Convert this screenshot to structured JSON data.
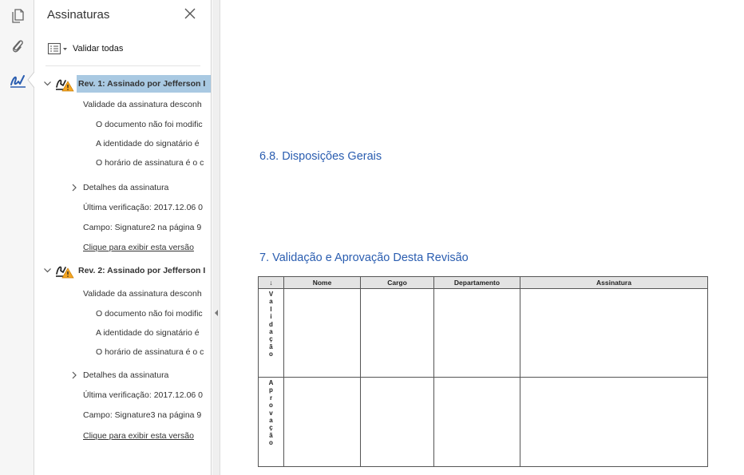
{
  "colors": {
    "accent": "#2a5db0",
    "selection": "#a9c9e2",
    "warning": "#f5a623"
  },
  "rail": {
    "icons": [
      "pages-icon",
      "attachment-icon",
      "signature-icon"
    ]
  },
  "panel": {
    "title": "Assinaturas",
    "validate_all_label": "Validar todas"
  },
  "revisions": [
    {
      "label": "Rev. 1: Assinado por Jefferson I",
      "validity": "Validade da assinatura desconh",
      "details": [
        "O documento não foi modific",
        "A identidade do signatário é",
        "O horário de assinatura é o c"
      ],
      "signature_details_label": "Detalhes da assinatura",
      "last_check": "Última verificação: 2017.12.06 0",
      "field": "Campo: Signature2 na página 9",
      "view_link": "Clique para exibir esta versão",
      "selected": true
    },
    {
      "label": "Rev. 2: Assinado por Jefferson I",
      "validity": "Validade da assinatura desconh",
      "details": [
        "O documento não foi modific",
        "A identidade do signatário é",
        "O horário de assinatura é o c"
      ],
      "signature_details_label": "Detalhes da assinatura",
      "last_check": "Última verificação: 2017.12.06 0",
      "field": "Campo: Signature3 na página 9",
      "view_link": "Clique para exibir esta versão",
      "selected": false
    }
  ],
  "document": {
    "section_68": "6.8.   Disposições Gerais",
    "section_7": "7. Validação e Aprovação Desta Revisão",
    "table": {
      "headers": [
        "↓",
        "Nome",
        "Cargo",
        "Departamento",
        "Assinatura"
      ],
      "rows": [
        {
          "label": "Validação",
          "letters": [
            "V",
            "a",
            "l",
            "i",
            "d",
            "a",
            "ç",
            "ã",
            "o"
          ]
        },
        {
          "label": "Aprovação",
          "letters": [
            "A",
            "p",
            "r",
            "o",
            "v",
            "a",
            "ç",
            "ã",
            "o"
          ]
        }
      ]
    }
  }
}
